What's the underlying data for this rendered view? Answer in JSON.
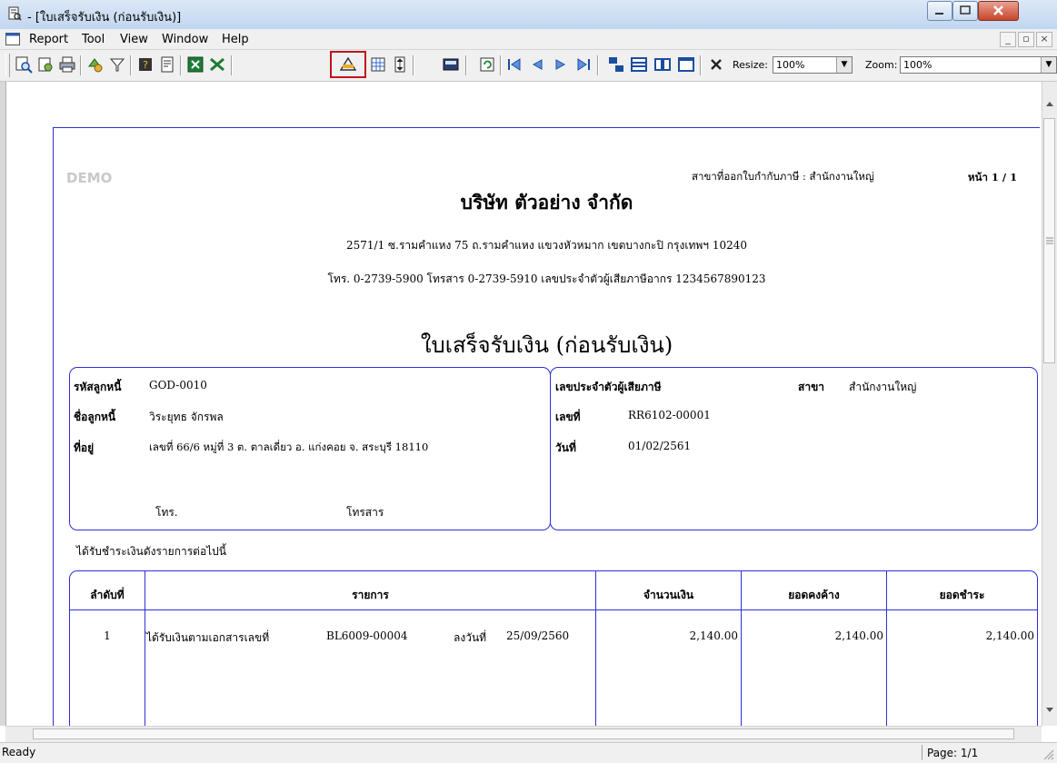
{
  "window": {
    "title": "- [ใบเสร็จรับเงิน (ก่อนรับเงิน)]"
  },
  "menu": [
    "Report",
    "Tool",
    "View",
    "Window",
    "Help"
  ],
  "toolbar": {
    "resize_label": "Resize:",
    "resize_value": "100%",
    "zoom_label": "Zoom:",
    "zoom_value": "100%"
  },
  "report": {
    "watermark": "DEMO",
    "branch_issuer": "สาขาที่ออกใบกำกับภาษี : สำนักงานใหญ่",
    "page_number": "หน้า 1 / 1",
    "company_name": "บริษัท ตัวอย่าง จำกัด",
    "address": "2571/1 ซ.รามคำแหง 75 ถ.รามคำแหง แขวงหัวหมาก เขตบางกะปิ กรุงเทพฯ 10240",
    "contact": "โทร. 0-2739-5900 โทรสาร 0-2739-5910 เลขประจำตัวผู้เสียภาษีอากร 1234567890123",
    "doc_title": "ใบเสร็จรับเงิน (ก่อนรับเงิน)",
    "customer": {
      "code_label": "รหัสลูกหนี้",
      "code": "GOD-0010",
      "name_label": "ชื่อลูกหนี้",
      "name": "วิระยุทธ จักรพล",
      "address_label": "ที่อยู่",
      "address": "เลขที่ 66/6 หมู่ที่ 3 ต. ตาลเดี่ยว อ. แก่งคอย จ. สระบุรี 18110",
      "tel_label": "โทร.",
      "fax_label": "โทรสาร"
    },
    "doc_info": {
      "tax_id_label": "เลขประจำตัวผู้เสียภาษี",
      "branch_label": "สาขา",
      "branch": "สำนักงานใหญ่",
      "doc_no_label": "เลขที่",
      "doc_no": "RR6102-00001",
      "date_label": "วันที่",
      "date": "01/02/2561"
    },
    "received_text": "ได้รับชำระเงินดังรายการต่อไปนี้",
    "table": {
      "headers": [
        "ลำดับที่",
        "รายการ",
        "จำนวนเงิน",
        "ยอดคงค้าง",
        "ยอดชำระ"
      ],
      "rows": [
        {
          "no": "1",
          "desc": "ได้รับเงินตามเอกสารเลขที่",
          "doc": "BL6009-00004",
          "date_label": "ลงวันที่",
          "date": "25/09/2560",
          "amount": "2,140.00",
          "balance": "2,140.00",
          "paid": "2,140.00"
        }
      ]
    }
  },
  "status": {
    "left": "Ready",
    "page": "Page: 1/1"
  }
}
